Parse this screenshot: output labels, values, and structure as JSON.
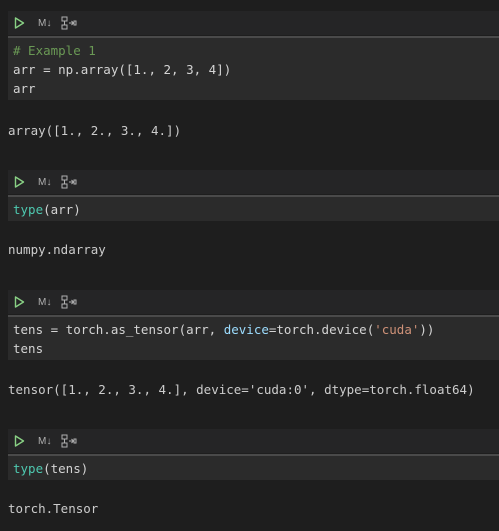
{
  "colors": {
    "background": "#1e1e1e",
    "toolbar": "#252526",
    "editor": "#2b2b2b",
    "run_icon": "#89d185",
    "comment": "#6a9955",
    "builtin": "#4ec9b0",
    "param": "#9cdcfe",
    "string": "#ce9178"
  },
  "toolbar": {
    "run_icon": "play-icon",
    "markdown_label": "M↓",
    "split_icon": "split-cell-icon"
  },
  "cells": [
    {
      "code": {
        "l1": "# Example 1",
        "l2": "arr = np.array([1., 2, 3, 4])",
        "l3": "arr"
      },
      "output": "array([1., 2., 3., 4.])"
    },
    {
      "code": {
        "l1_fn": "type",
        "l1_rest": "(arr)"
      },
      "output": "numpy.ndarray"
    },
    {
      "code": {
        "l1_a": "tens = torch.as_tensor(arr, ",
        "l1_param": "device",
        "l1_b": "=torch.device(",
        "l1_str": "'cuda'",
        "l1_c": "))",
        "l2": "tens"
      },
      "output": "tensor([1., 2., 3., 4.], device='cuda:0', dtype=torch.float64)"
    },
    {
      "code": {
        "l1_fn": "type",
        "l1_rest": "(tens)"
      },
      "output": "torch.Tensor"
    }
  ]
}
